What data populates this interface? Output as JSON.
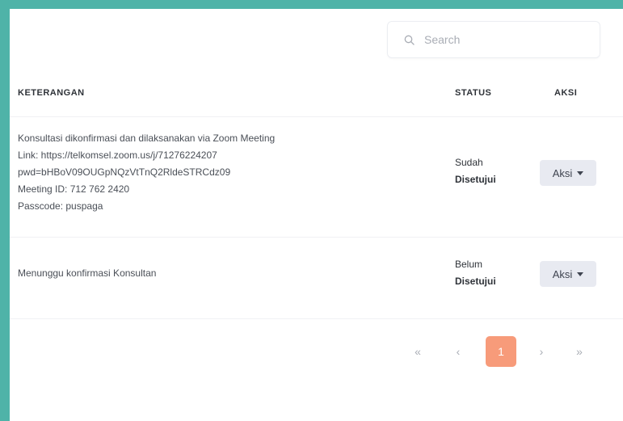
{
  "search": {
    "placeholder": "Search",
    "icon": "search-icon"
  },
  "table": {
    "headers": {
      "keterangan": "KETERANGAN",
      "status": "STATUS",
      "aksi": "AKSI"
    },
    "rows": [
      {
        "keterangan": [
          "Konsultasi dikonfirmasi dan dilaksanakan via Zoom Meeting",
          "Link: https://telkomsel.zoom.us/j/71276224207",
          "pwd=bHBoV09OUGpNQzVtTnQ2RldeSTRCdz09",
          "Meeting ID: 712 762 2420",
          "Passcode: puspaga"
        ],
        "status_line1": "Sudah",
        "status_line2": "Disetujui",
        "action_label": "Aksi"
      },
      {
        "keterangan": [
          "Menunggu konfirmasi Konsultan"
        ],
        "status_line1": "Belum",
        "status_line2": "Disetujui",
        "action_label": "Aksi"
      }
    ]
  },
  "pagination": {
    "first": "«",
    "prev": "‹",
    "current": "1",
    "next": "›",
    "last": "»"
  },
  "colors": {
    "accent": "#f79b7a",
    "frame": "#4fb3a8",
    "button_bg": "#e8eaf1"
  }
}
